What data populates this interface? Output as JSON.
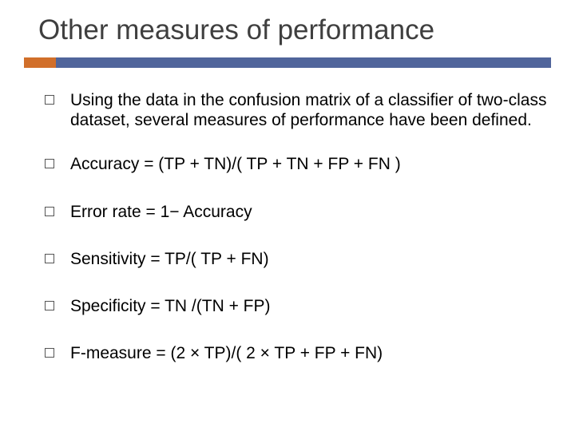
{
  "title": "Other measures of performance",
  "bullets": [
    "Using the data in the confusion matrix of a classifier of two-class dataset, several measures of performance have been defined.",
    "Accuracy = (TP + TN)/( TP + TN + FP + FN )",
    "Error rate = 1− Accuracy",
    "Sensitivity = TP/( TP + FN)",
    "Specificity = TN /(TN + FP)",
    "F-measure = (2 × TP)/( 2 × TP + FP + FN)"
  ],
  "colors": {
    "accent": "#d16f2a",
    "rule": "#50659b",
    "title": "#3f3f3f"
  }
}
